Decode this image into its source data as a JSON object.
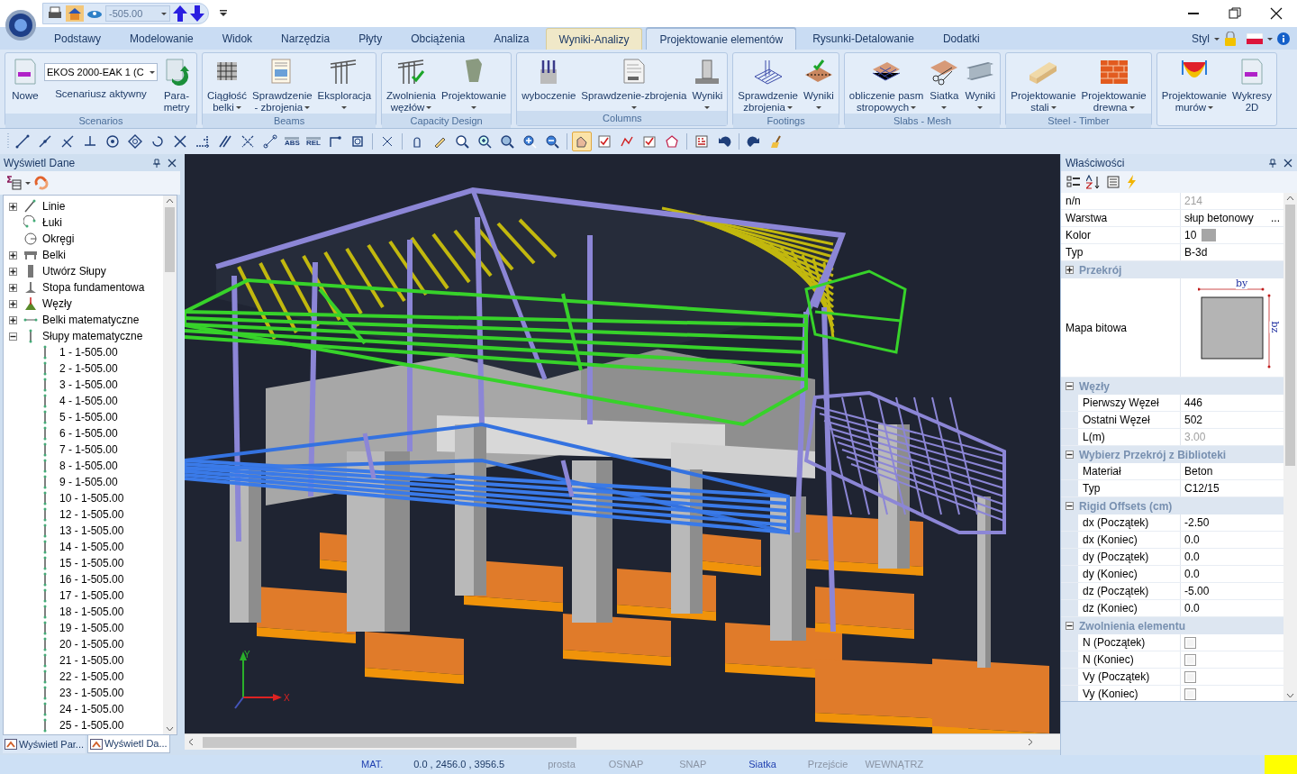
{
  "quick_access": {
    "value": "-505.00"
  },
  "ribbon_tabs": [
    {
      "label": "Podstawy",
      "selected": false,
      "contextual": false
    },
    {
      "label": "Modelowanie",
      "selected": false,
      "contextual": false
    },
    {
      "label": "Widok",
      "selected": false,
      "contextual": false
    },
    {
      "label": "Narzędzia",
      "selected": false,
      "contextual": false
    },
    {
      "label": "Płyty",
      "selected": false,
      "contextual": false
    },
    {
      "label": "Obciążenia",
      "selected": false,
      "contextual": false
    },
    {
      "label": "Analiza",
      "selected": false,
      "contextual": false
    },
    {
      "label": "Wyniki-Analizy",
      "selected": false,
      "contextual": true
    },
    {
      "label": "Projektowanie elementów",
      "selected": true,
      "contextual": false
    },
    {
      "label": "Rysunki-Detalowanie",
      "selected": false,
      "contextual": false
    },
    {
      "label": "Dodatki",
      "selected": false,
      "contextual": false
    }
  ],
  "style_menu": {
    "label": "Styl"
  },
  "ribbon_groups": [
    {
      "title": "Scenarios",
      "items": [
        {
          "kind": "button",
          "label_lines": [
            "Nowe"
          ],
          "dropdown": false
        },
        {
          "kind": "combo",
          "value": "EKOS 2000-EAK 1 (C",
          "label": "Scenariusz aktywny"
        },
        {
          "kind": "button",
          "label_lines": [
            "Para-",
            "metry"
          ],
          "dropdown": false
        }
      ]
    },
    {
      "title": "Beams",
      "items": [
        {
          "kind": "button",
          "label_lines": [
            "Ciągłość",
            "belki"
          ],
          "dropdown": true
        },
        {
          "kind": "button",
          "label_lines": [
            "Sprawdzenie",
            "- zbrojenia"
          ],
          "dropdown": true
        },
        {
          "kind": "button",
          "label_lines": [
            "Eksploracja"
          ],
          "dropdown": true
        }
      ]
    },
    {
      "title": "Capacity Design",
      "items": [
        {
          "kind": "button",
          "label_lines": [
            "Zwolnienia",
            "węzłów"
          ],
          "dropdown": true
        },
        {
          "kind": "button",
          "label_lines": [
            "Projektowanie"
          ],
          "dropdown": true
        }
      ]
    },
    {
      "title": "Columns",
      "items": [
        {
          "kind": "button",
          "label_lines": [
            "wyboczenie"
          ],
          "dropdown": false
        },
        {
          "kind": "button",
          "label_lines": [
            "Sprawdzenie-zbrojenia"
          ],
          "dropdown": true
        },
        {
          "kind": "button",
          "label_lines": [
            "Wyniki"
          ],
          "dropdown": true
        }
      ]
    },
    {
      "title": "Footings",
      "items": [
        {
          "kind": "button",
          "label_lines": [
            "Sprawdzenie",
            "zbrojenia"
          ],
          "dropdown": true
        },
        {
          "kind": "button",
          "label_lines": [
            "Wyniki"
          ],
          "dropdown": true
        }
      ]
    },
    {
      "title": "Slabs - Mesh",
      "items": [
        {
          "kind": "button",
          "label_lines": [
            "obliczenie pasm",
            "stropowych"
          ],
          "dropdown": true
        },
        {
          "kind": "button",
          "label_lines": [
            "Siatka"
          ],
          "dropdown": true
        },
        {
          "kind": "button",
          "label_lines": [
            "Wyniki"
          ],
          "dropdown": true
        }
      ]
    },
    {
      "title": "Steel - Timber",
      "items": [
        {
          "kind": "button",
          "label_lines": [
            "Projektowanie",
            "stali"
          ],
          "dropdown": true
        },
        {
          "kind": "button",
          "label_lines": [
            "Projektowanie",
            "drewna"
          ],
          "dropdown": true
        }
      ]
    },
    {
      "items": [
        {
          "kind": "button",
          "label_lines": [
            "Projektowanie",
            "murów"
          ],
          "dropdown": true
        },
        {
          "kind": "button",
          "label_lines": [
            "Wykresy",
            "2D"
          ],
          "dropdown": false
        }
      ]
    }
  ],
  "toolbar": [
    {
      "kind": "icon",
      "pressed": false
    },
    {
      "kind": "icon",
      "pressed": false
    },
    {
      "kind": "icon",
      "pressed": false
    },
    {
      "kind": "icon",
      "pressed": false
    },
    {
      "kind": "icon",
      "pressed": false
    },
    {
      "kind": "icon",
      "pressed": false
    },
    {
      "kind": "icon",
      "pressed": false
    },
    {
      "kind": "icon",
      "pressed": false
    },
    {
      "kind": "icon",
      "pressed": false
    },
    {
      "kind": "icon",
      "pressed": false
    },
    {
      "kind": "icon",
      "pressed": false
    },
    {
      "kind": "icon",
      "pressed": false
    },
    {
      "kind": "label",
      "label": "ABS",
      "pressed": false
    },
    {
      "kind": "label",
      "label": "REL",
      "pressed": false
    },
    {
      "kind": "icon",
      "pressed": false
    },
    {
      "kind": "icon",
      "pressed": false
    },
    {
      "kind": "icon",
      "pressed": false
    },
    {
      "kind": "icon",
      "pressed": false
    },
    {
      "kind": "icon",
      "pressed": false
    },
    {
      "kind": "icon",
      "pressed": false
    },
    {
      "kind": "icon",
      "pressed": false
    },
    {
      "kind": "icon",
      "pressed": false
    },
    {
      "kind": "icon",
      "pressed": false
    },
    {
      "kind": "icon",
      "pressed": false
    },
    {
      "kind": "icon",
      "pressed": true
    },
    {
      "kind": "icon",
      "pressed": false
    },
    {
      "kind": "icon",
      "pressed": false
    },
    {
      "kind": "icon",
      "pressed": false
    },
    {
      "kind": "icon",
      "pressed": false
    },
    {
      "kind": "icon",
      "pressed": false
    },
    {
      "kind": "icon",
      "pressed": false
    },
    {
      "kind": "icon",
      "pressed": false
    },
    {
      "kind": "icon",
      "pressed": false
    }
  ],
  "left_panel": {
    "title": "Wyświetl Dane",
    "tree": [
      {
        "label": "Linie",
        "expandable": true,
        "expanded": false
      },
      {
        "label": "Łuki",
        "expandable": false
      },
      {
        "label": "Okręgi",
        "expandable": false
      },
      {
        "label": "Belki",
        "expandable": true,
        "expanded": false
      },
      {
        "label": "Utwórz Słupy",
        "expandable": true,
        "expanded": false
      },
      {
        "label": "Stopa fundamentowa",
        "expandable": true,
        "expanded": false
      },
      {
        "label": "Węzły",
        "expandable": true,
        "expanded": false
      },
      {
        "label": "Belki matematyczne",
        "expandable": true,
        "expanded": false
      },
      {
        "label": "Słupy matematyczne",
        "expandable": true,
        "expanded": true,
        "children": [
          {
            "label": "1 - 1-505.00"
          },
          {
            "label": "2 - 1-505.00"
          },
          {
            "label": "3 - 1-505.00"
          },
          {
            "label": "4 - 1-505.00"
          },
          {
            "label": "5 - 1-505.00"
          },
          {
            "label": "6 - 1-505.00"
          },
          {
            "label": "7 - 1-505.00"
          },
          {
            "label": "8 - 1-505.00"
          },
          {
            "label": "9 - 1-505.00"
          },
          {
            "label": "10 - 1-505.00"
          },
          {
            "label": "12 - 1-505.00"
          },
          {
            "label": "13 - 1-505.00"
          },
          {
            "label": "14 - 1-505.00"
          },
          {
            "label": "15 - 1-505.00"
          },
          {
            "label": "16 - 1-505.00"
          },
          {
            "label": "17 - 1-505.00"
          },
          {
            "label": "18 - 1-505.00"
          },
          {
            "label": "19 - 1-505.00"
          },
          {
            "label": "20 - 1-505.00"
          },
          {
            "label": "21 - 1-505.00"
          },
          {
            "label": "22 - 1-505.00"
          },
          {
            "label": "23 - 1-505.00"
          },
          {
            "label": "24 - 1-505.00"
          },
          {
            "label": "25 - 1-505.00"
          }
        ]
      }
    ],
    "tabs": [
      {
        "label": "Wyświetl Par...",
        "selected": false
      },
      {
        "label": "Wyświetl Da...",
        "selected": true
      }
    ]
  },
  "viewport": {
    "axis_labels": [
      "Y",
      "X"
    ]
  },
  "properties": {
    "title": "Właściwości",
    "items": [
      {
        "kind": "row",
        "label": "n/n",
        "value": "214",
        "readonly": true
      },
      {
        "kind": "row",
        "label": "Warstwa",
        "value": "słup betonowy",
        "readonly": false,
        "ellipsis": "..."
      },
      {
        "kind": "row",
        "label": "Kolor",
        "value": "10",
        "readonly": false,
        "color": "#a6a6a6"
      },
      {
        "kind": "row",
        "label": "Typ",
        "value": "B-3d",
        "readonly": false
      },
      {
        "kind": "category",
        "label": "Przekrój",
        "expanded": false
      },
      {
        "kind": "bitmap",
        "label": "Mapa bitowa",
        "dims": [
          "by",
          "bz"
        ]
      },
      {
        "kind": "category",
        "label": "Węzły",
        "expanded": true,
        "children": [
          {
            "kind": "row",
            "label": "Pierwszy Węzeł",
            "value": "446",
            "readonly": false
          },
          {
            "kind": "row",
            "label": "Ostatni Węzeł",
            "value": "502",
            "readonly": false
          },
          {
            "kind": "row",
            "label": "L(m)",
            "value": "3.00",
            "readonly": true
          }
        ]
      },
      {
        "kind": "category",
        "label": "Wybierz Przekrój z Biblioteki",
        "expanded": true,
        "children": [
          {
            "kind": "row",
            "label": "Materiał",
            "value": "Beton",
            "readonly": false
          },
          {
            "kind": "row",
            "label": "Typ",
            "value": "C12/15",
            "readonly": false
          }
        ]
      },
      {
        "kind": "category",
        "label": "Rigid Offsets (cm)",
        "expanded": true,
        "children": [
          {
            "kind": "row",
            "label": "dx (Początek)",
            "value": "-2.50",
            "readonly": false
          },
          {
            "kind": "row",
            "label": "dx (Koniec)",
            "value": "0.0",
            "readonly": false
          },
          {
            "kind": "row",
            "label": "dy (Początek)",
            "value": "0.0",
            "readonly": false
          },
          {
            "kind": "row",
            "label": "dy (Koniec)",
            "value": "0.0",
            "readonly": false
          },
          {
            "kind": "row",
            "label": "dz (Początek)",
            "value": "-5.00",
            "readonly": false
          },
          {
            "kind": "row",
            "label": "dz (Koniec)",
            "value": "0.0",
            "readonly": false
          }
        ]
      },
      {
        "kind": "category",
        "label": "Zwolnienia elementu",
        "expanded": true,
        "children": [
          {
            "kind": "check",
            "label": "N (Początek)",
            "checked": false
          },
          {
            "kind": "check",
            "label": "N (Koniec)",
            "checked": false
          },
          {
            "kind": "check",
            "label": "Vy (Początek)",
            "checked": false
          },
          {
            "kind": "check",
            "label": "Vy (Koniec)",
            "checked": false
          }
        ]
      }
    ]
  },
  "status_bar": {
    "items": [
      {
        "kind": "toggle",
        "label": "MAT.",
        "on": true
      },
      {
        "kind": "coords",
        "label": "0.0 , 2456.0 , 3956.5"
      },
      {
        "kind": "toggle",
        "label": "prosta",
        "on": false
      },
      {
        "kind": "toggle",
        "label": "OSNAP",
        "on": false
      },
      {
        "kind": "toggle",
        "label": "SNAP",
        "on": false
      },
      {
        "kind": "toggle",
        "label": "Siatka",
        "on": true
      },
      {
        "kind": "toggle",
        "label": "Przejście",
        "on": false
      },
      {
        "kind": "toggle",
        "label": "WEWNĄTRZ",
        "on": false
      }
    ]
  }
}
